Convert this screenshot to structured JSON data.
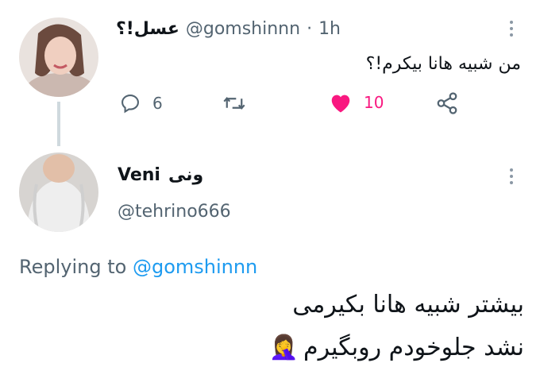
{
  "parent_tweet": {
    "display_name": "عسل!؟",
    "handle": "@gomshinnn",
    "separator": "·",
    "time": "1h",
    "text": "من شبیه هانا بیکرم!؟",
    "actions": {
      "reply_count": "6",
      "like_count": "10"
    }
  },
  "reply_tweet": {
    "display_name_latin": "Veni",
    "display_name_fa": "ونی",
    "handle": "@tehrino666",
    "replying_to_prefix": "Replying to",
    "replying_to_handle": "@gomshinnn",
    "text_line1": "بیشتر شبیه هانا بکیرمی",
    "text_line2": "نشد جلوخودم روبگیرم",
    "emoji": "🤦‍♀️"
  },
  "colors": {
    "like": "#f91880",
    "link": "#1d9bf0",
    "muted": "#536471",
    "thread_line": "#cfd9de"
  }
}
